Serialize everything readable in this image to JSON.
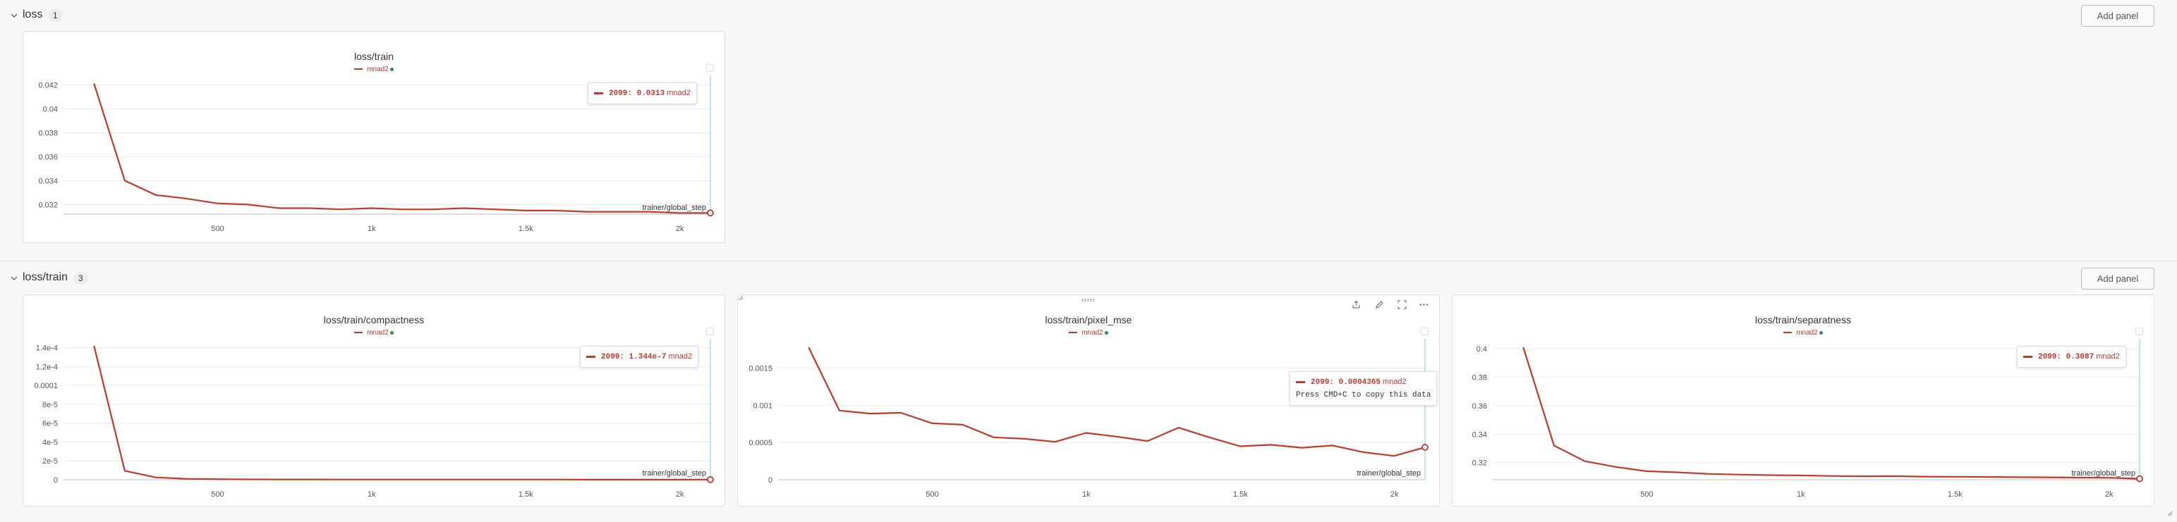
{
  "sections": [
    {
      "title": "loss",
      "count": "1",
      "add_panel": "Add panel"
    },
    {
      "title": "loss/train",
      "count": "3",
      "add_panel": "Add panel"
    }
  ],
  "panels": [
    {
      "title": "loss/train",
      "legend": "mnad2",
      "tooltip": {
        "step": "2099",
        "value": "0.0313",
        "run": "mnad2"
      }
    },
    {
      "title": "loss/train/compactness",
      "legend": "mnad2",
      "tooltip": {
        "step": "2099",
        "value": "1.344e-7",
        "run": "mnad2"
      }
    },
    {
      "title": "loss/train/pixel_mse",
      "legend": "mnad2",
      "tooltip": {
        "step": "2099",
        "value": "0.0004365",
        "run": "mnad2",
        "copy_hint": "Press CMD+C to copy this data"
      }
    },
    {
      "title": "loss/train/separatness",
      "legend": "mnad2",
      "tooltip": {
        "step": "2099",
        "value": "0.3087",
        "run": "mnad2"
      }
    }
  ],
  "colors": {
    "series": "#c0392b",
    "hover_line": "#7ec8d8",
    "run_dot": "#2e8b57"
  },
  "icons": [
    "chevron-down-icon",
    "share-icon",
    "edit-icon",
    "fullscreen-icon",
    "more-icon",
    "drag-handle-icon",
    "resize-icon"
  ],
  "chart_data": [
    {
      "type": "line",
      "title": "loss/train",
      "xlabel": "trainer/global_step",
      "ylabel": "",
      "xlim": [
        0,
        2099
      ],
      "ylim": [
        0.0312,
        0.0422
      ],
      "x_ticks": [
        "500",
        "1k",
        "1.5k",
        "2k"
      ],
      "x_tick_values": [
        500,
        1000,
        1500,
        2000
      ],
      "y_ticks": [
        "0.032",
        "0.034",
        "0.036",
        "0.038",
        "0.04",
        "0.042"
      ],
      "y_tick_values": [
        0.032,
        0.034,
        0.036,
        0.038,
        0.04,
        0.042
      ],
      "series": [
        {
          "name": "mnad2",
          "x": [
            99,
            199,
            299,
            399,
            499,
            599,
            699,
            799,
            899,
            999,
            1099,
            1199,
            1299,
            1399,
            1499,
            1599,
            1699,
            1799,
            1899,
            1999,
            2099
          ],
          "y": [
            0.0421,
            0.034,
            0.0328,
            0.0325,
            0.0321,
            0.032,
            0.0317,
            0.0317,
            0.0316,
            0.0317,
            0.0316,
            0.0316,
            0.0317,
            0.0316,
            0.0315,
            0.0315,
            0.0314,
            0.0314,
            0.0314,
            0.0313,
            0.0313
          ]
        }
      ]
    },
    {
      "type": "line",
      "title": "loss/train/compactness",
      "xlabel": "trainer/global_step",
      "ylabel": "",
      "xlim": [
        0,
        2099
      ],
      "ylim": [
        0,
        0.000142
      ],
      "x_ticks": [
        "500",
        "1k",
        "1.5k",
        "2k"
      ],
      "x_tick_values": [
        500,
        1000,
        1500,
        2000
      ],
      "y_ticks": [
        "0",
        "2e-5",
        "4e-5",
        "6e-5",
        "8e-5",
        "0.0001",
        "1.2e-4",
        "1.4e-4"
      ],
      "y_tick_values": [
        0,
        2e-05,
        4e-05,
        6e-05,
        8e-05,
        0.0001,
        0.00012,
        0.00014
      ],
      "series": [
        {
          "name": "mnad2",
          "x": [
            99,
            199,
            299,
            399,
            499,
            599,
            699,
            799,
            899,
            999,
            1099,
            1199,
            1299,
            1399,
            1499,
            1599,
            1699,
            1799,
            1899,
            1999,
            2099
          ],
          "y": [
            0.000142,
            9.5e-06,
            2.5e-06,
            1e-06,
            6e-07,
            4e-07,
            3e-07,
            3e-07,
            2e-07,
            2e-07,
            2e-07,
            2e-07,
            2e-07,
            2e-07,
            2e-07,
            2e-07,
            1e-07,
            1e-07,
            1e-07,
            1e-07,
            1.344e-07
          ]
        }
      ]
    },
    {
      "type": "line",
      "title": "loss/train/pixel_mse",
      "xlabel": "trainer/global_step",
      "ylabel": "",
      "xlim": [
        0,
        2099
      ],
      "ylim": [
        0,
        0.0018
      ],
      "x_ticks": [
        "500",
        "1k",
        "1.5k",
        "2k"
      ],
      "x_tick_values": [
        500,
        1000,
        1500,
        2000
      ],
      "y_ticks": [
        "0",
        "0.0005",
        "0.001",
        "0.0015"
      ],
      "y_tick_values": [
        0,
        0.0005,
        0.001,
        0.0015
      ],
      "series": [
        {
          "name": "mnad2",
          "x": [
            99,
            199,
            299,
            399,
            499,
            599,
            699,
            799,
            899,
            999,
            1099,
            1199,
            1299,
            1399,
            1499,
            1599,
            1699,
            1799,
            1899,
            1999,
            2099
          ],
          "y": [
            0.00178,
            0.00093,
            0.00089,
            0.0009,
            0.00076,
            0.00074,
            0.00057,
            0.00055,
            0.00051,
            0.00063,
            0.00058,
            0.00052,
            0.0007,
            0.00057,
            0.00045,
            0.00047,
            0.00043,
            0.00046,
            0.00037,
            0.00032,
            0.0004365
          ]
        }
      ]
    },
    {
      "type": "line",
      "title": "loss/train/separatness",
      "xlabel": "trainer/global_step",
      "ylabel": "",
      "xlim": [
        0,
        2099
      ],
      "ylim": [
        0.308,
        0.402
      ],
      "x_ticks": [
        "500",
        "1k",
        "1.5k",
        "2k"
      ],
      "x_tick_values": [
        500,
        1000,
        1500,
        2000
      ],
      "y_ticks": [
        "0.32",
        "0.34",
        "0.36",
        "0.38",
        "0.4"
      ],
      "y_tick_values": [
        0.32,
        0.34,
        0.36,
        0.38,
        0.4
      ],
      "series": [
        {
          "name": "mnad2",
          "x": [
            99,
            199,
            299,
            399,
            499,
            599,
            699,
            799,
            899,
            999,
            1099,
            1199,
            1299,
            1399,
            1499,
            1599,
            1699,
            1799,
            1899,
            1999,
            2099
          ],
          "y": [
            0.401,
            0.332,
            0.321,
            0.317,
            0.314,
            0.3132,
            0.3121,
            0.3116,
            0.3112,
            0.311,
            0.3106,
            0.3104,
            0.3105,
            0.3102,
            0.3101,
            0.31,
            0.3098,
            0.3097,
            0.3095,
            0.3094,
            0.3087
          ]
        }
      ]
    }
  ]
}
